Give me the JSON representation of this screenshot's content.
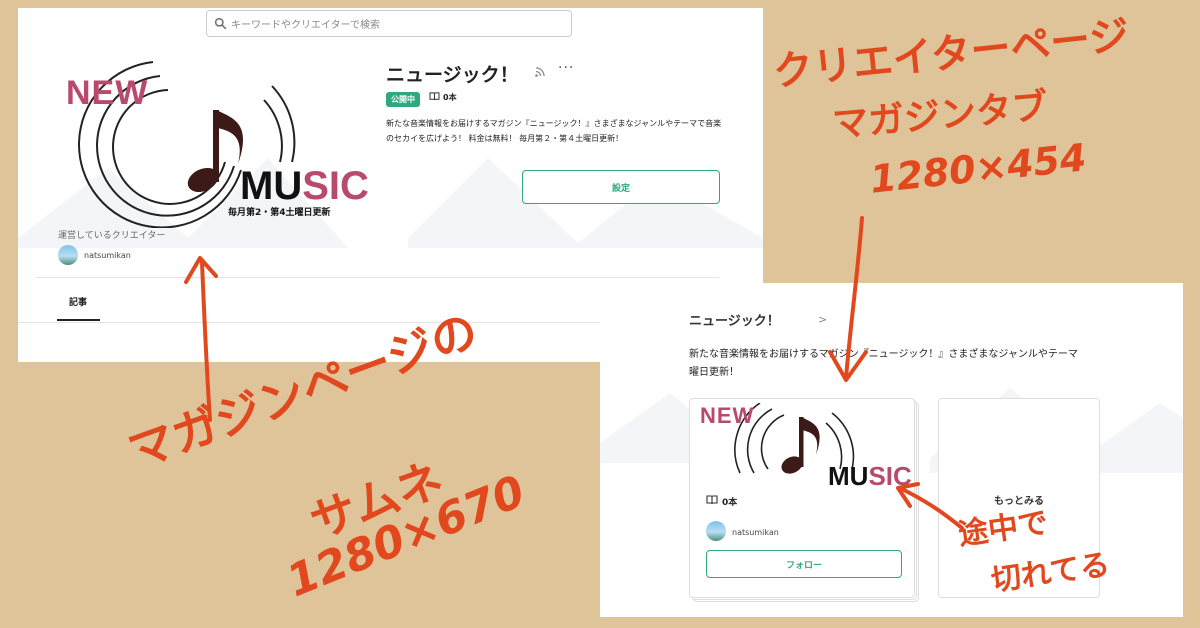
{
  "magazine_page": {
    "search_placeholder": "キーワードやクリエイターで検索",
    "logo": {
      "new": "NEW",
      "music_prefix": "MU",
      "music_suffix": "SIC",
      "schedule": "毎月第2・第4土曜日更新"
    },
    "title": "ニュージック！",
    "status_badge": "公開中",
    "article_count": "0本",
    "description": "新たな音楽情報をお届けするマガジン『ニュージック！』さまざまなジャンルやテーマで音楽のセカイを広げよう！ 料金は無料！ 毎月第２・第４土曜日更新！",
    "settings_label": "設定",
    "operator_label": "運営しているクリエイター",
    "creator_name": "natsumikan",
    "tab_articles": "記事"
  },
  "creator_page_tab": {
    "title": "ニュージック！",
    "description": "新たな音楽情報をお届けするマガジン『ニュージック！』さまざまなジャンルやテーマ\n曜日更新！",
    "logo": {
      "new": "NEW",
      "music_prefix": "MU",
      "music_suffix": "SIC"
    },
    "article_count": "0本",
    "creator_name": "natsumikan",
    "follow_label": "フォロー",
    "more_label": "もっとみる"
  },
  "annotations": {
    "creator_page_line1": "クリエイターページ",
    "creator_page_line2": "マガジンタブ",
    "creator_page_size": "1280×454",
    "magazine_page_line1": "マガジンページの",
    "magazine_page_line2": "サムネ",
    "magazine_page_size": "1280×670",
    "cut_line1": "途中で",
    "cut_line2": "切れてる"
  },
  "colors": {
    "accent_green": "#2ea87e",
    "logo_pink": "#b84b6c",
    "annotation_orange": "#e2481e",
    "background": "#dfc49a"
  }
}
